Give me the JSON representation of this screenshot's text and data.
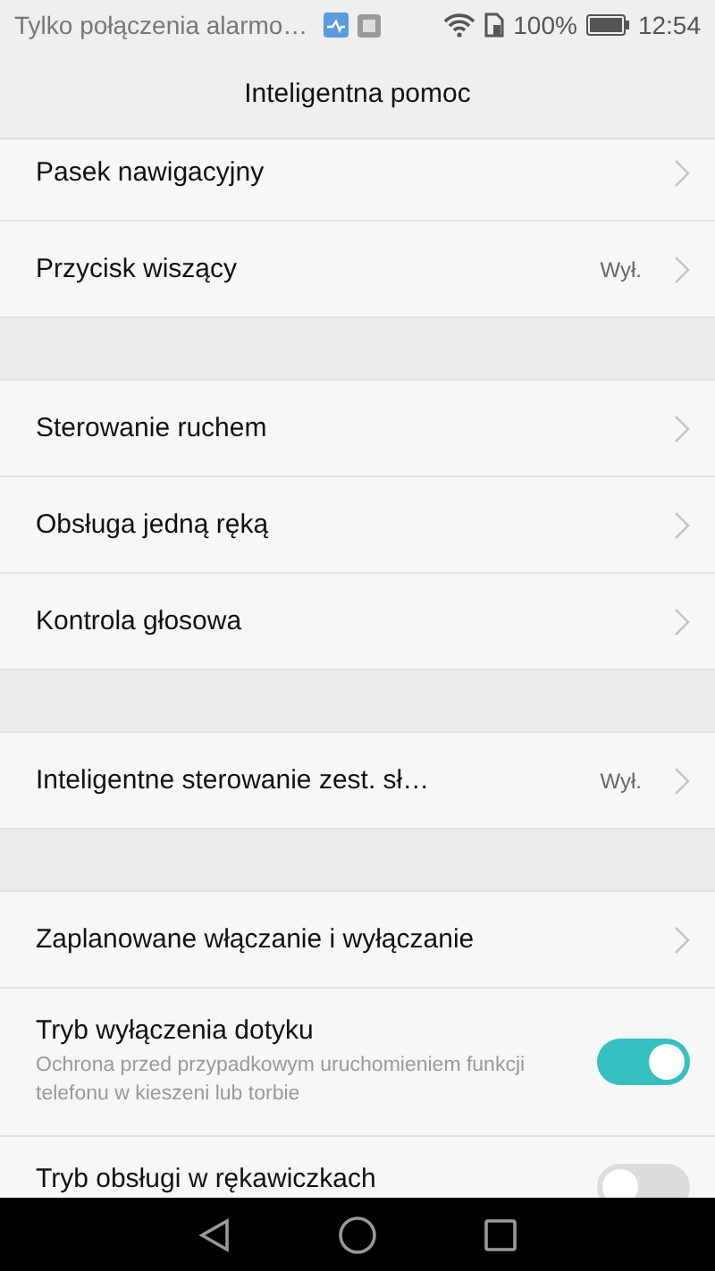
{
  "status_bar": {
    "notification": "Tylko połączenia alarmo…",
    "battery_percent": "100%",
    "time": "12:54"
  },
  "title": "Inteligentna pomoc",
  "sections": [
    {
      "items": [
        {
          "kind": "link",
          "title": "Pasek nawigacyjny"
        },
        {
          "kind": "link",
          "title": "Przycisk wiszący",
          "value": "Wył."
        }
      ]
    },
    {
      "items": [
        {
          "kind": "link",
          "title": "Sterowanie ruchem"
        },
        {
          "kind": "link",
          "title": "Obsługa jedną ręką"
        },
        {
          "kind": "link",
          "title": "Kontrola głosowa"
        }
      ]
    },
    {
      "items": [
        {
          "kind": "link",
          "title": "Inteligentne sterowanie zest. sł…",
          "value": "Wył."
        }
      ]
    },
    {
      "items": [
        {
          "kind": "link",
          "title": "Zaplanowane włączanie i wyłączanie"
        },
        {
          "kind": "toggle",
          "title": "Tryb wyłączenia dotyku",
          "subtitle": "Ochrona przed przypadkowym uruchomieniem funkcji telefonu w kieszeni lub torbie",
          "on": true
        },
        {
          "kind": "toggle",
          "title": "Tryb obsługi w rękawiczkach",
          "on": false
        }
      ]
    }
  ]
}
